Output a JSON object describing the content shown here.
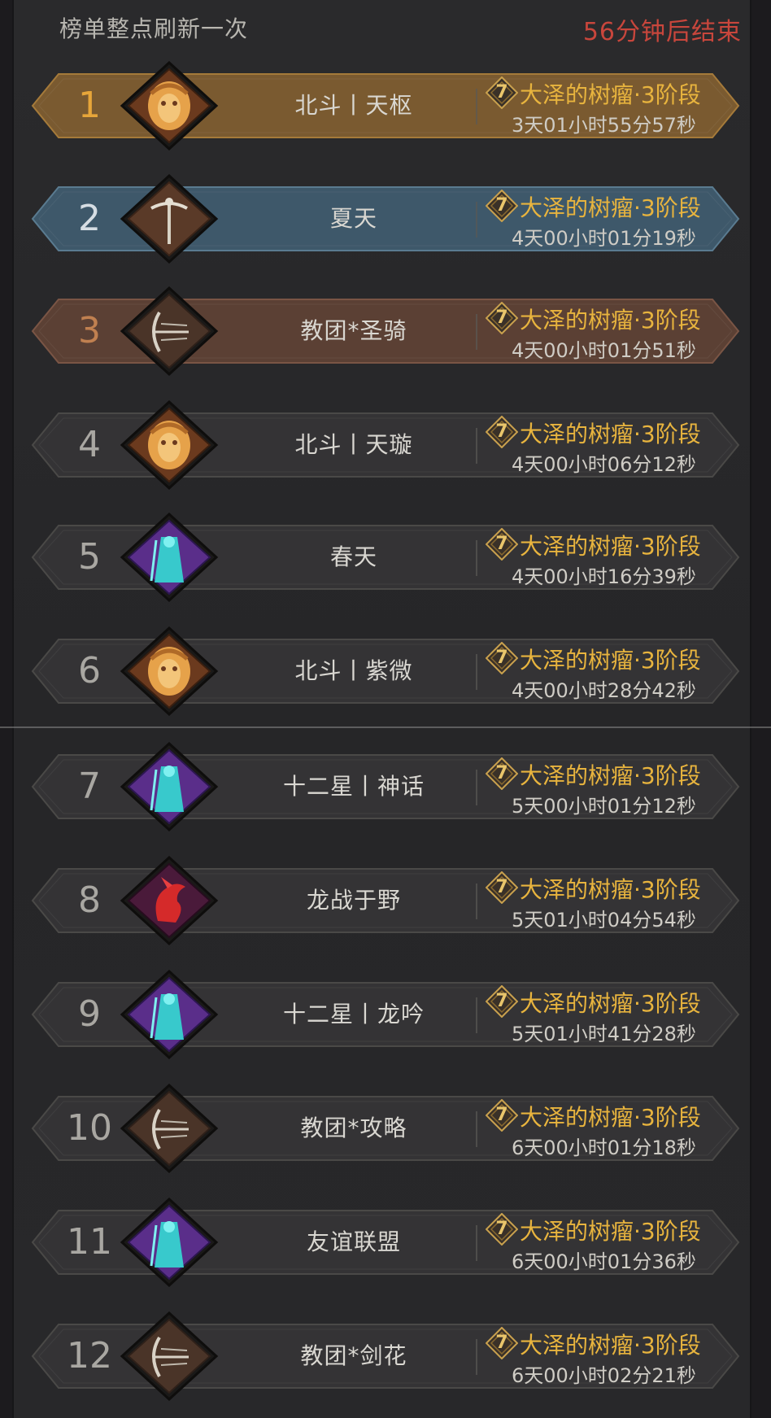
{
  "header": {
    "refresh_note": "榜单整点刷新一次",
    "countdown": "56分钟后结束"
  },
  "colors": {
    "rank1_band": "#7a5a30",
    "rank2_band": "#3e586a",
    "rank3_band": "#5b4034",
    "default_band": "#343335",
    "stage_text": "#e8b43e",
    "countdown_text": "#c8463c"
  },
  "rows": [
    {
      "rank": "1",
      "guild": "北斗丨天枢",
      "badge": "7",
      "stage": "大泽的树瘤·3阶段",
      "time": "3天01小时55分57秒",
      "emblem": "golden-lion-emblem-icon",
      "tier": "gold"
    },
    {
      "rank": "2",
      "guild": "夏天",
      "badge": "7",
      "stage": "大泽的树瘤·3阶段",
      "time": "4天00小时01分19秒",
      "emblem": "caduceus-emblem-icon",
      "tier": "silver"
    },
    {
      "rank": "3",
      "guild": "教团*圣骑",
      "badge": "7",
      "stage": "大泽的树瘤·3阶段",
      "time": "4天00小时01分51秒",
      "emblem": "bow-emblem-icon",
      "tier": "bronze"
    },
    {
      "rank": "4",
      "guild": "北斗丨天璇",
      "badge": "7",
      "stage": "大泽的树瘤·3阶段",
      "time": "4天00小时06分12秒",
      "emblem": "golden-lion-emblem-icon",
      "tier": "normal"
    },
    {
      "rank": "5",
      "guild": "春天",
      "badge": "7",
      "stage": "大泽的树瘤·3阶段",
      "time": "4天00小时16分39秒",
      "emblem": "mage-emblem-icon",
      "tier": "normal"
    },
    {
      "rank": "6",
      "guild": "北斗丨紫微",
      "badge": "7",
      "stage": "大泽的树瘤·3阶段",
      "time": "4天00小时28分42秒",
      "emblem": "golden-lion-emblem-icon",
      "tier": "normal"
    },
    {
      "rank": "7",
      "guild": "十二星丨神话",
      "badge": "7",
      "stage": "大泽的树瘤·3阶段",
      "time": "5天00小时01分12秒",
      "emblem": "mage-emblem-icon",
      "tier": "normal"
    },
    {
      "rank": "8",
      "guild": "龙战于野",
      "badge": "7",
      "stage": "大泽的树瘤·3阶段",
      "time": "5天01小时04分54秒",
      "emblem": "red-dragon-emblem-icon",
      "tier": "normal"
    },
    {
      "rank": "9",
      "guild": "十二星丨龙吟",
      "badge": "7",
      "stage": "大泽的树瘤·3阶段",
      "time": "5天01小时41分28秒",
      "emblem": "mage-emblem-icon",
      "tier": "normal"
    },
    {
      "rank": "10",
      "guild": "教团*攻略",
      "badge": "7",
      "stage": "大泽的树瘤·3阶段",
      "time": "6天00小时01分18秒",
      "emblem": "bow-emblem-icon",
      "tier": "normal"
    },
    {
      "rank": "11",
      "guild": "友谊联盟",
      "badge": "7",
      "stage": "大泽的树瘤·3阶段",
      "time": "6天00小时01分36秒",
      "emblem": "mage-emblem-icon",
      "tier": "normal"
    },
    {
      "rank": "12",
      "guild": "教团*剑花",
      "badge": "7",
      "stage": "大泽的树瘤·3阶段",
      "time": "6天00小时02分21秒",
      "emblem": "bow-emblem-icon",
      "tier": "normal"
    }
  ]
}
